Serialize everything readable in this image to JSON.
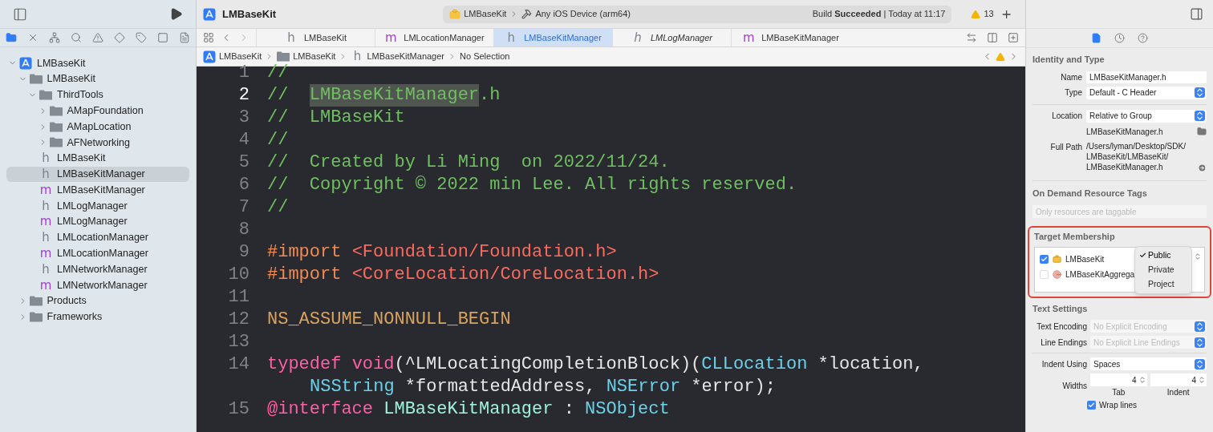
{
  "toolbar": {
    "project_name": "LMBaseKit",
    "scheme": "LMBaseKit",
    "destination": "Any iOS Device (arm64)",
    "build_status": "Build **Succeeded** | Today at 11:17",
    "warning_count": "13"
  },
  "navigator_tabs": [
    {
      "selected": true
    },
    {
      "selected": false
    },
    {
      "selected": false
    },
    {
      "selected": false
    },
    {
      "selected": false
    },
    {
      "selected": false
    },
    {
      "selected": false
    },
    {
      "selected": false
    },
    {
      "selected": false
    }
  ],
  "tree": [
    {
      "kind": "project",
      "label": "LMBaseKit",
      "expanded": true,
      "selected": false,
      "children": [
        {
          "kind": "folder",
          "label": "LMBaseKit",
          "expanded": true,
          "selected": false,
          "children": [
            {
              "kind": "folder",
              "label": "ThirdTools",
              "expanded": true,
              "selected": false,
              "children": [
                {
                  "kind": "folder",
                  "label": "AMapFoundation",
                  "expanded": false,
                  "selected": false
                },
                {
                  "kind": "folder",
                  "label": "AMapLocation",
                  "expanded": false,
                  "selected": false
                },
                {
                  "kind": "folder",
                  "label": "AFNetworking",
                  "expanded": false,
                  "selected": false
                }
              ]
            },
            {
              "kind": "header",
              "icon": "h",
              "label": "LMBaseKit",
              "selected": false
            },
            {
              "kind": "header",
              "icon": "h",
              "label": "LMBaseKitManager",
              "selected": true
            },
            {
              "kind": "impl",
              "icon": "m",
              "label": "LMBaseKitManager",
              "selected": false
            },
            {
              "kind": "header",
              "icon": "h",
              "label": "LMLogManager",
              "selected": false
            },
            {
              "kind": "impl",
              "icon": "m",
              "label": "LMLogManager",
              "selected": false
            },
            {
              "kind": "header",
              "icon": "h",
              "label": "LMLocationManager",
              "selected": false
            },
            {
              "kind": "impl",
              "icon": "m",
              "label": "LMLocationManager",
              "selected": false
            },
            {
              "kind": "header",
              "icon": "h",
              "label": "LMNetworkManager",
              "selected": false
            },
            {
              "kind": "impl",
              "icon": "m",
              "label": "LMNetworkManager",
              "selected": false
            }
          ]
        },
        {
          "kind": "folder",
          "label": "Products",
          "expanded": false,
          "selected": false
        },
        {
          "kind": "folder",
          "label": "Frameworks",
          "expanded": false,
          "selected": false
        }
      ]
    }
  ],
  "editor_tabs": [
    {
      "kind": "header",
      "icon": "h",
      "label": "LMBaseKit",
      "selected": false,
      "preview": false
    },
    {
      "kind": "impl",
      "icon": "m",
      "label": "LMLocationManager",
      "selected": false,
      "preview": false
    },
    {
      "kind": "header",
      "icon": "h",
      "label": "LMBaseKitManager",
      "selected": true,
      "preview": false
    },
    {
      "kind": "header",
      "icon": "h",
      "label": "LMLogManager",
      "selected": false,
      "preview": true
    },
    {
      "kind": "impl",
      "icon": "m",
      "label": "LMBaseKitManager",
      "selected": false,
      "preview": false
    }
  ],
  "breadcrumb": [
    {
      "kind": "project",
      "label": "LMBaseKit"
    },
    {
      "kind": "folder",
      "label": "LMBaseKit"
    },
    {
      "kind": "header",
      "icon": "h",
      "label": "LMBaseKitManager"
    },
    {
      "kind": "none",
      "label": "No Selection"
    }
  ],
  "code_lines": [
    {
      "number": "1",
      "current": false,
      "segments": [
        {
          "kind": "comment",
          "text": "//"
        }
      ]
    },
    {
      "number": "2",
      "current": true,
      "segments": [
        {
          "kind": "comment",
          "text": "//  "
        },
        {
          "kind": "match",
          "text": "LMBaseKitManager"
        },
        {
          "kind": "comment",
          "text": ".h"
        }
      ]
    },
    {
      "number": "3",
      "current": false,
      "segments": [
        {
          "kind": "comment",
          "text": "//  LMBaseKit"
        }
      ]
    },
    {
      "number": "4",
      "current": false,
      "segments": [
        {
          "kind": "comment",
          "text": "//"
        }
      ]
    },
    {
      "number": "5",
      "current": false,
      "segments": [
        {
          "kind": "comment",
          "text": "//  Created by Li Ming  on 2022/11/24."
        }
      ]
    },
    {
      "number": "6",
      "current": false,
      "segments": [
        {
          "kind": "comment",
          "text": "//  Copyright © 2022 min Lee. All rights reserved."
        }
      ]
    },
    {
      "number": "7",
      "current": false,
      "segments": [
        {
          "kind": "comment",
          "text": "//"
        }
      ]
    },
    {
      "number": "8",
      "current": false
    },
    {
      "number": "9",
      "current": false,
      "segments": [
        {
          "kind": "preprocessor",
          "text": "#import "
        },
        {
          "kind": "string",
          "text": "<Foundation/Foundation.h>"
        }
      ]
    },
    {
      "number": "10",
      "current": false,
      "segments": [
        {
          "kind": "preprocessor",
          "text": "#import "
        },
        {
          "kind": "string",
          "text": "<CoreLocation/CoreLocation.h>"
        }
      ]
    },
    {
      "number": "11",
      "current": false
    },
    {
      "number": "12",
      "current": false,
      "segments": [
        {
          "kind": "macro",
          "text": "NS_ASSUME_NONNULL_BEGIN"
        }
      ]
    },
    {
      "number": "13",
      "current": false
    },
    {
      "number": "14",
      "current": false,
      "segments": [
        {
          "kind": "keyword",
          "text": "typedef "
        },
        {
          "kind": "keyword",
          "text": "void"
        },
        {
          "kind": "plain",
          "text": "(^LMLocatingCompletionBlock)("
        },
        {
          "kind": "type",
          "text": "CLLocation"
        },
        {
          "kind": "plain",
          "text": " *location,"
        }
      ],
      "continuation": [
        {
          "kind": "type",
          "text": "NSString"
        },
        {
          "kind": "plain",
          "text": " *formattedAddress, "
        },
        {
          "kind": "type",
          "text": "NSError"
        },
        {
          "kind": "plain",
          "text": " *error);"
        }
      ]
    },
    {
      "number": "15",
      "current": false,
      "segments": [
        {
          "kind": "keyword",
          "text": "@interface "
        },
        {
          "kind": "decl",
          "text": "LMBaseKitManager"
        },
        {
          "kind": "plain",
          "text": " : "
        },
        {
          "kind": "type",
          "text": "NSObject"
        }
      ]
    }
  ],
  "inspector": {
    "tabs": [
      {
        "kind": "file",
        "selected": true
      },
      {
        "kind": "history",
        "selected": false
      },
      {
        "kind": "help",
        "selected": false
      }
    ],
    "identity": {
      "title": "Identity and Type",
      "name_label": "Name",
      "name_value": "LMBaseKitManager.h",
      "type_label": "Type",
      "type_value": "Default - C Header",
      "location_label": "Location",
      "location_value": "Relative to Group",
      "location_file": "LMBaseKitManager.h",
      "full_path_label": "Full Path",
      "full_path": "/Users/lyman/Desktop/SDK/\nLMBaseKit/LMBaseKit/\nLMBaseKitManager.h"
    },
    "tags": {
      "title": "On Demand Resource Tags",
      "placeholder": "Only resources are taggable"
    },
    "membership": {
      "title": "Target Membership",
      "targets": [
        {
          "kind": "framework",
          "label": "LMBaseKit",
          "checked": true
        },
        {
          "kind": "aggregate",
          "label": "LMBaseKitAggrega",
          "checked": false
        }
      ],
      "menu": [
        {
          "label": "Public",
          "selected": true
        },
        {
          "label": "Private",
          "selected": false
        },
        {
          "label": "Project",
          "selected": false
        }
      ]
    },
    "text_settings": {
      "title": "Text Settings",
      "encoding_label": "Text Encoding",
      "encoding_placeholder": "No Explicit Encoding",
      "endings_label": "Line Endings",
      "endings_placeholder": "No Explicit Line Endings",
      "indent_label": "Indent Using",
      "indent_value": "Spaces",
      "widths_label": "Widths",
      "tab_value": "4",
      "tab_label": "Tab",
      "indent_width_value": "4",
      "indent_width_label": "Indent",
      "wrap_label": "Wrap lines",
      "wrap_checked": true
    }
  }
}
